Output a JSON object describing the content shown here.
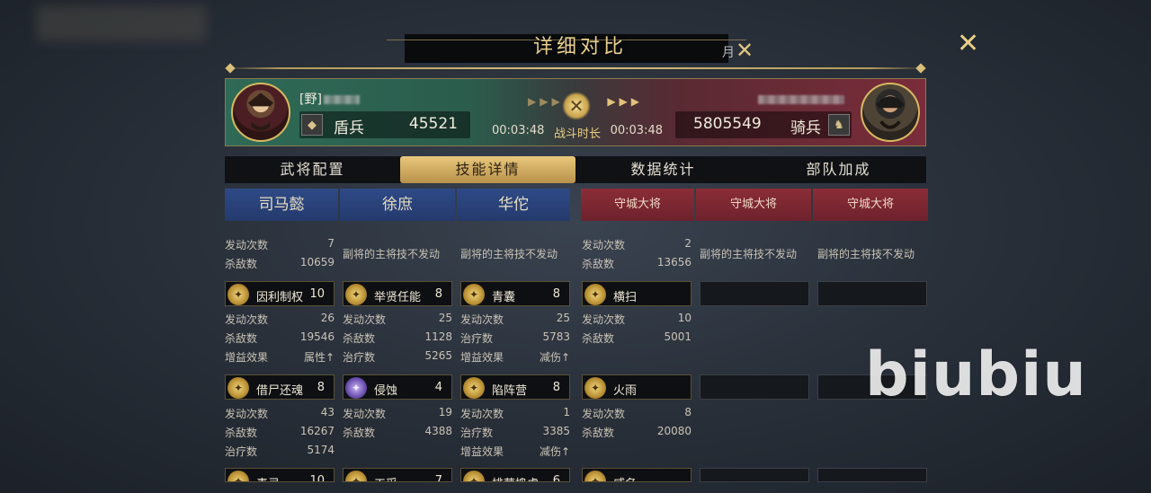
{
  "header": {
    "title": "详细对比",
    "title_fragment": "月"
  },
  "close_icon": "close-icon",
  "banner": {
    "left": {
      "name_prefix": "[野]",
      "unit_type": "盾兵",
      "troops": "45521"
    },
    "right": {
      "unit_type": "骑兵",
      "troops": "5805549"
    },
    "time_left": "00:03:48",
    "time_right": "00:03:48",
    "time_label": "战斗时长",
    "colors": {
      "left": "#2f6a57",
      "right": "#7a2c3a",
      "gold": "#e7cf8c"
    }
  },
  "tabs": [
    {
      "label": "武将配置",
      "active": false
    },
    {
      "label": "技能详情",
      "active": true
    },
    {
      "label": "数据统计",
      "active": false
    },
    {
      "label": "部队加成",
      "active": false
    }
  ],
  "generals": {
    "left": [
      "司马懿",
      "徐庶",
      "华佗"
    ],
    "right": [
      "守城大将",
      "守城大将",
      "守城大将"
    ]
  },
  "columns": {
    "c1": {
      "top": [
        {
          "k": "发动次数",
          "v": "7"
        },
        {
          "k": "杀敌数",
          "v": "10659"
        }
      ],
      "skills": [
        {
          "name": "因利制权",
          "level": "10",
          "stats": [
            {
              "k": "发动次数",
              "v": "26"
            },
            {
              "k": "杀敌数",
              "v": "19546"
            },
            {
              "k": "增益效果",
              "v": "属性↑"
            }
          ]
        },
        {
          "name": "借尸还魂",
          "level": "8",
          "stats": [
            {
              "k": "发动次数",
              "v": "43"
            },
            {
              "k": "杀敌数",
              "v": "16267"
            },
            {
              "k": "治疗数",
              "v": "5174"
            }
          ]
        },
        {
          "name": "毒弓",
          "level": "10"
        }
      ]
    },
    "c2": {
      "note": "副将的主将技不发动",
      "skills": [
        {
          "name": "举贤任能",
          "level": "8",
          "stats": [
            {
              "k": "发动次数",
              "v": "25"
            },
            {
              "k": "杀敌数",
              "v": "1128"
            },
            {
              "k": "治疗数",
              "v": "5265"
            }
          ]
        },
        {
          "name": "侵蚀",
          "level": "4",
          "stats": [
            {
              "k": "发动次数",
              "v": "19"
            },
            {
              "k": "杀敌数",
              "v": "4388"
            }
          ]
        },
        {
          "name": "工采",
          "level": "7"
        }
      ]
    },
    "c3": {
      "note": "副将的主将技不发动",
      "skills": [
        {
          "name": "青囊",
          "level": "8",
          "stats": [
            {
              "k": "发动次数",
              "v": "25"
            },
            {
              "k": "治疗数",
              "v": "5783"
            },
            {
              "k": "增益效果",
              "v": "减伤↑"
            }
          ]
        },
        {
          "name": "陷阵营",
          "level": "8",
          "stats": [
            {
              "k": "发动次数",
              "v": "1"
            },
            {
              "k": "治疗数",
              "v": "3385"
            },
            {
              "k": "增益效果",
              "v": "减伤↑"
            }
          ]
        },
        {
          "name": "排营捣虎",
          "level": "6"
        }
      ]
    },
    "c4": {
      "top": [
        {
          "k": "发动次数",
          "v": "2"
        },
        {
          "k": "杀敌数",
          "v": "13656"
        }
      ],
      "skills": [
        {
          "name": "横扫",
          "level": "",
          "stats": [
            {
              "k": "发动次数",
              "v": "10"
            },
            {
              "k": "杀敌数",
              "v": "5001"
            }
          ]
        },
        {
          "name": "火雨",
          "level": "",
          "stats": [
            {
              "k": "发动次数",
              "v": "8"
            },
            {
              "k": "杀敌数",
              "v": "20080"
            }
          ]
        },
        {
          "name": "威名",
          "level": ""
        }
      ]
    },
    "c5": {
      "note": "副将的主将技不发动"
    },
    "c6": {
      "note": "副将的主将技不发动"
    }
  },
  "watermark": "biubiu"
}
